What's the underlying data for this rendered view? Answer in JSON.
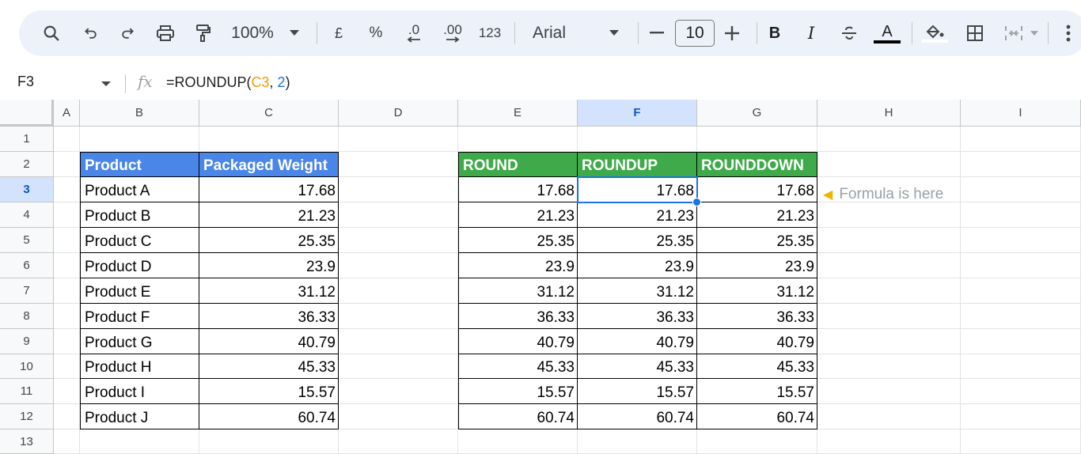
{
  "toolbar": {
    "zoom": "100%",
    "currency": "£",
    "percent": "%",
    "decrease_decimal": ".0",
    "increase_decimal": ".00",
    "number_format": "123",
    "font": "Arial",
    "font_size": "10",
    "bold": "B",
    "italic": "I",
    "text_color_letter": "A"
  },
  "formula_bar": {
    "cell_ref": "F3",
    "formula_prefix": "=ROUNDUP(",
    "formula_ref": "C3",
    "formula_sep": ", ",
    "formula_arg": "2",
    "formula_suffix": ")"
  },
  "columns": [
    "A",
    "B",
    "C",
    "D",
    "E",
    "F",
    "G",
    "H",
    "I"
  ],
  "selected_column": "F",
  "rows": [
    "1",
    "2",
    "3",
    "4",
    "5",
    "6",
    "7",
    "8",
    "9",
    "10",
    "11",
    "12",
    "13"
  ],
  "selected_row": "3",
  "colors": {
    "header_blue": "#4a86e8",
    "header_green": "#3eaa4a",
    "selection": "#1a73e8"
  },
  "table1": {
    "headers": [
      "Product",
      "Packaged Weight"
    ],
    "rows": [
      [
        "Product A",
        "17.68"
      ],
      [
        "Product B",
        "21.23"
      ],
      [
        "Product C",
        "25.35"
      ],
      [
        "Product D",
        "23.9"
      ],
      [
        "Product E",
        "31.12"
      ],
      [
        "Product F",
        "36.33"
      ],
      [
        "Product G",
        "40.79"
      ],
      [
        "Product H",
        "45.33"
      ],
      [
        "Product I",
        "15.57"
      ],
      [
        "Product J",
        "60.74"
      ]
    ]
  },
  "table2": {
    "headers": [
      "ROUND",
      "ROUNDUP",
      "ROUNDDOWN"
    ],
    "rows": [
      [
        "17.68",
        "17.68",
        "17.68"
      ],
      [
        "21.23",
        "21.23",
        "21.23"
      ],
      [
        "25.35",
        "25.35",
        "25.35"
      ],
      [
        "23.9",
        "23.9",
        "23.9"
      ],
      [
        "31.12",
        "31.12",
        "31.12"
      ],
      [
        "36.33",
        "36.33",
        "36.33"
      ],
      [
        "40.79",
        "40.79",
        "40.79"
      ],
      [
        "45.33",
        "45.33",
        "45.33"
      ],
      [
        "15.57",
        "15.57",
        "15.57"
      ],
      [
        "60.74",
        "60.74",
        "60.74"
      ]
    ]
  },
  "note": {
    "icon": "pointing-hand-icon",
    "text": "Formula is here"
  }
}
